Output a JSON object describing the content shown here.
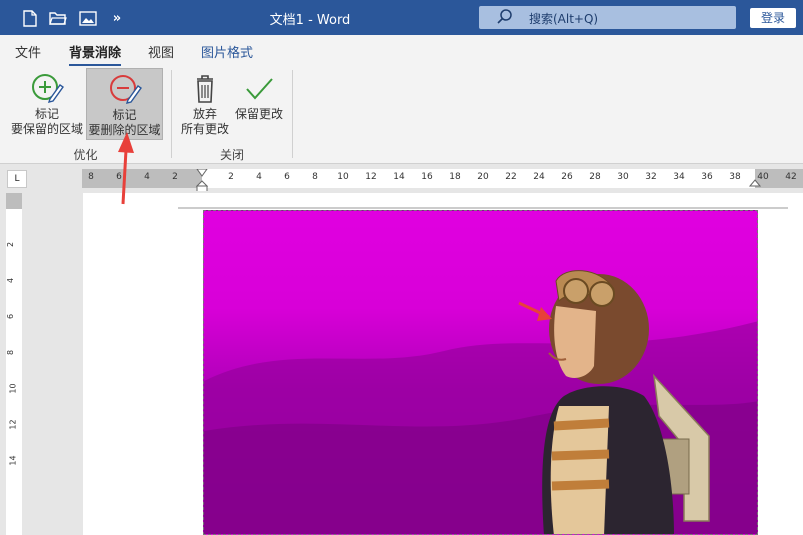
{
  "titlebar": {
    "title": "文档1  -  Word",
    "search_placeholder": "搜索(Alt+Q)",
    "login_label": "登录",
    "more_label": "»"
  },
  "tabs": [
    "文件",
    "背景消除",
    "视图",
    "图片格式"
  ],
  "ribbon": {
    "mark_keep": {
      "line1": "标记",
      "line2": "要保留的区域"
    },
    "mark_remove": {
      "line1": "标记",
      "line2": "要删除的区域"
    },
    "group_optimize": "优化",
    "discard": {
      "line1": "放弃",
      "line2": "所有更改"
    },
    "keep_changes": {
      "line1": "保留更改"
    },
    "group_close": "关闭"
  },
  "ruler": {
    "corner": "L",
    "h_ticks": [
      "8",
      "6",
      "4",
      "2",
      "2",
      "4",
      "6",
      "8",
      "10",
      "12",
      "14",
      "16",
      "18",
      "20",
      "22",
      "24",
      "26",
      "28",
      "30",
      "32",
      "34",
      "36",
      "38",
      "40",
      "42"
    ],
    "v_ticks": [
      "2",
      "4",
      "6",
      "8",
      "10",
      "12",
      "14"
    ]
  },
  "colors": {
    "title_blue": "#2b579a",
    "removal_magenta": "#e000e0",
    "annotation_red": "#e8403a"
  }
}
